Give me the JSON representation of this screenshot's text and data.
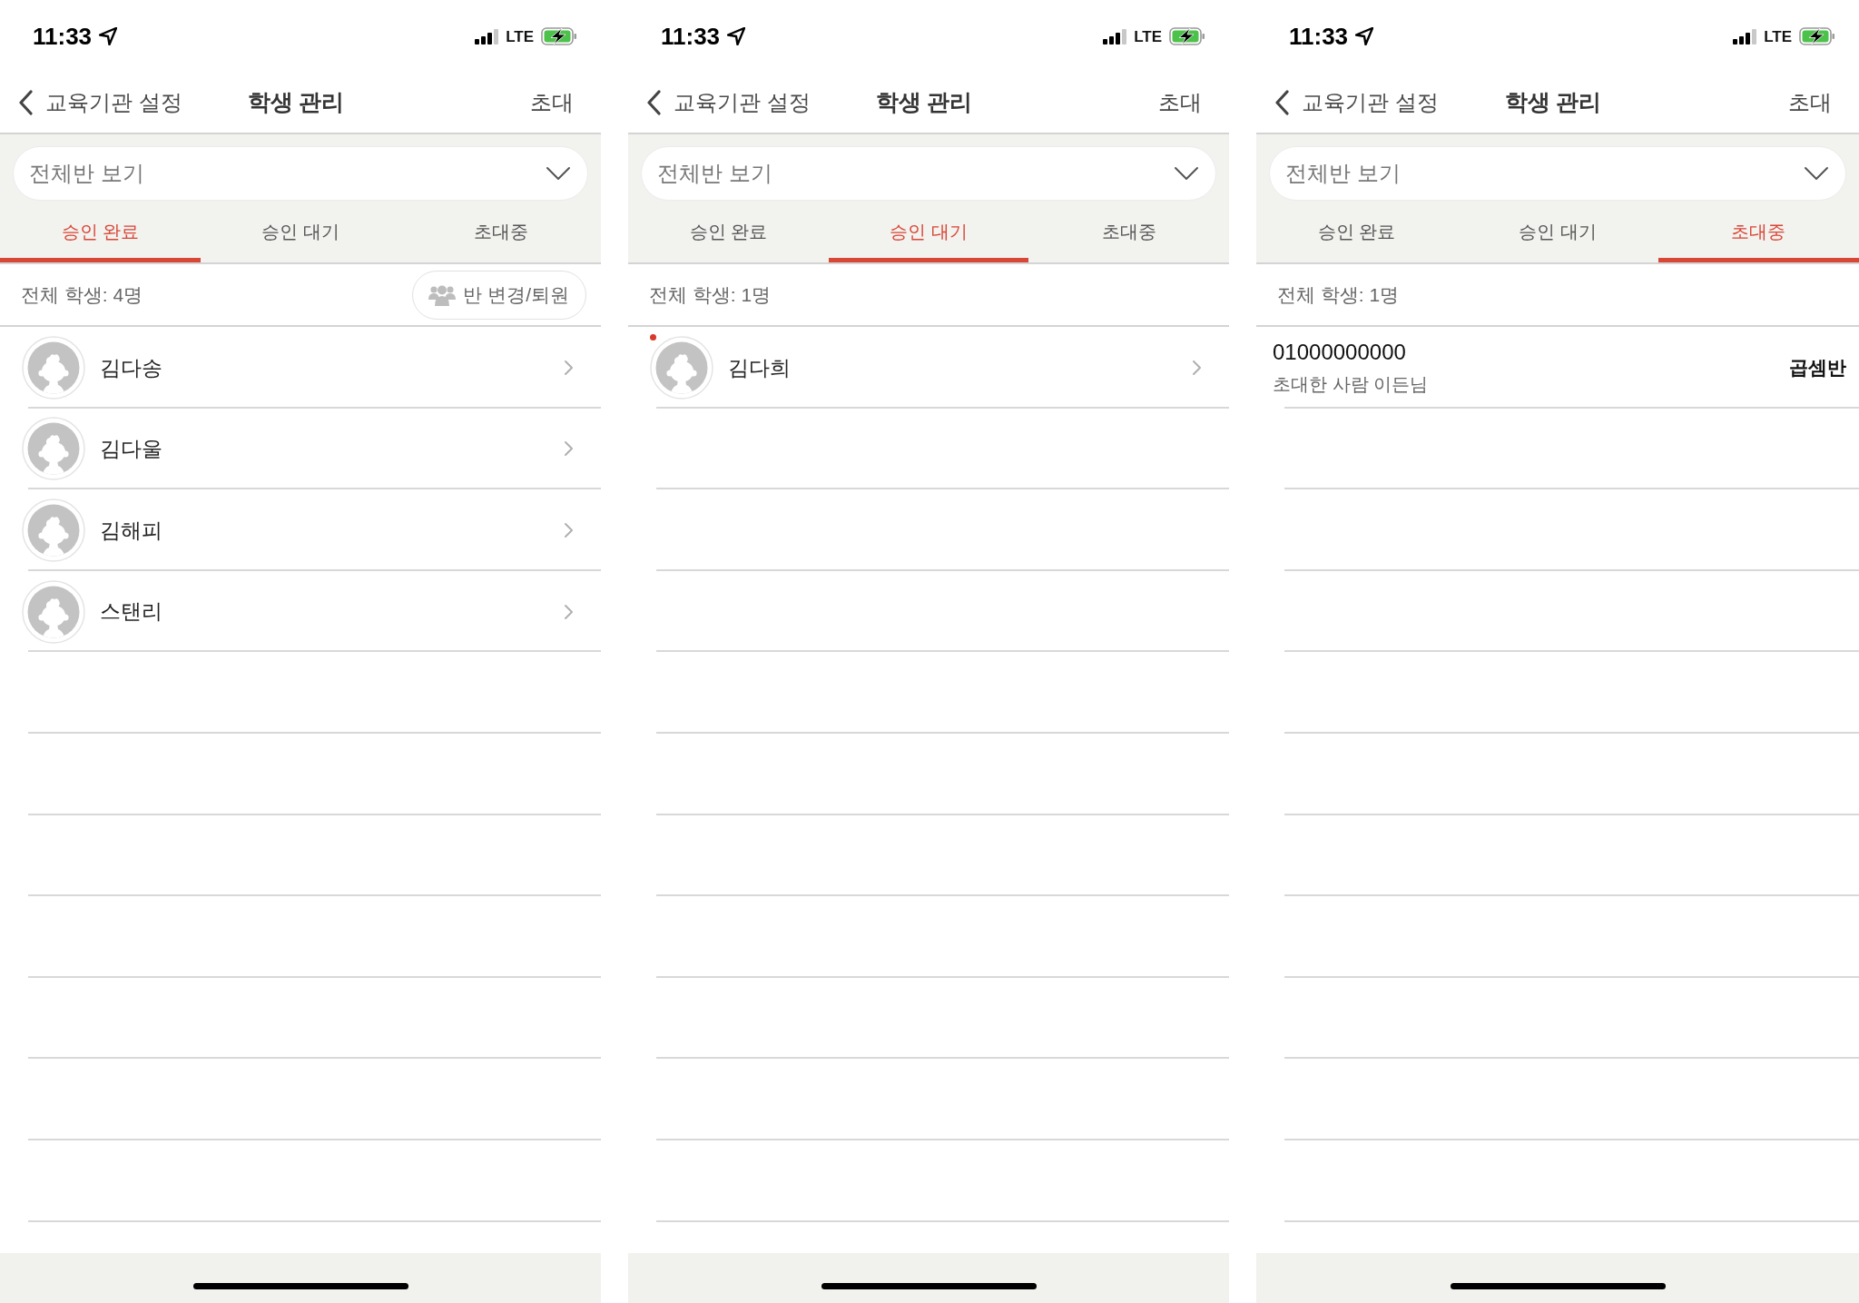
{
  "screens": [
    {
      "status_bar": {
        "time": "11:33",
        "network": "LTE"
      },
      "nav_bar": {
        "back_label": "교육기관 설정",
        "title": "학생 관리",
        "action": "초대"
      },
      "class_filter": {
        "value": "전체반 보기"
      },
      "tabs": [
        {
          "label": "승인 완료",
          "selected": true
        },
        {
          "label": "승인 대기",
          "selected": false
        },
        {
          "label": "초대중",
          "selected": false
        }
      ],
      "summary": {
        "text": "전체 학생: 4명",
        "button": "반 변경/퇴원"
      },
      "rows": [
        {
          "kind": "student",
          "name": "김다송",
          "unread": false
        },
        {
          "kind": "student",
          "name": "김다울",
          "unread": false
        },
        {
          "kind": "student",
          "name": "김해피",
          "unread": false
        },
        {
          "kind": "student",
          "name": "스탠리",
          "unread": false
        }
      ]
    },
    {
      "status_bar": {
        "time": "11:33",
        "network": "LTE"
      },
      "nav_bar": {
        "back_label": "교육기관 설정",
        "title": "학생 관리",
        "action": "초대"
      },
      "class_filter": {
        "value": "전체반 보기"
      },
      "tabs": [
        {
          "label": "승인 완료",
          "selected": false
        },
        {
          "label": "승인 대기",
          "selected": true
        },
        {
          "label": "초대중",
          "selected": false
        }
      ],
      "summary": {
        "text": "전체 학생: 1명"
      },
      "rows": [
        {
          "kind": "student",
          "name": "김다희",
          "unread": true
        }
      ]
    },
    {
      "status_bar": {
        "time": "11:33",
        "network": "LTE"
      },
      "nav_bar": {
        "back_label": "교육기관 설정",
        "title": "학생 관리",
        "action": "초대"
      },
      "class_filter": {
        "value": "전체반 보기"
      },
      "tabs": [
        {
          "label": "승인 완료",
          "selected": false
        },
        {
          "label": "승인 대기",
          "selected": false
        },
        {
          "label": "초대중",
          "selected": true
        }
      ],
      "summary": {
        "text": "전체 학생: 1명"
      },
      "rows": [
        {
          "kind": "invitation",
          "phone": "01000000000",
          "inviter": "초대한 사람 이든님",
          "class_name": "곱셈반",
          "unread": false
        }
      ]
    }
  ]
}
